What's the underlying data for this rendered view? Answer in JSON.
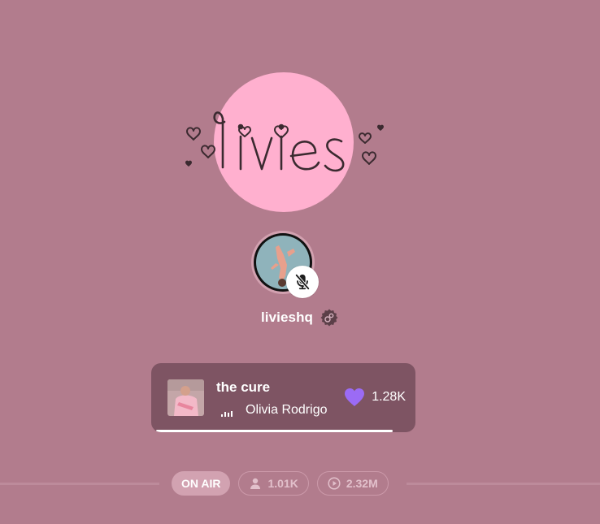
{
  "profile": {
    "logo_text": "livies",
    "username": "livieshq",
    "avatar_alt": "profile photo",
    "mic_status": "muted"
  },
  "now_playing": {
    "title": "the cure",
    "artist": "Olivia Rodrigo",
    "likes": "1.28K",
    "progress": 0.93
  },
  "stats": {
    "on_air_label": "ON AIR",
    "listeners": "1.01K",
    "plays": "2.32M"
  },
  "colors": {
    "background": "#b27c8d",
    "logo_circle": "#ffb0cf",
    "card": "#7e5463",
    "heart": "#9b6bf5",
    "on_air_pill": "#d2a2b1"
  },
  "icons": {
    "mute": "microphone-off-icon",
    "badge": "verified-badge-icon",
    "equalizer": "equalizer-icon",
    "heart": "heart-icon",
    "listeners": "person-icon",
    "plays": "play-circle-icon"
  }
}
